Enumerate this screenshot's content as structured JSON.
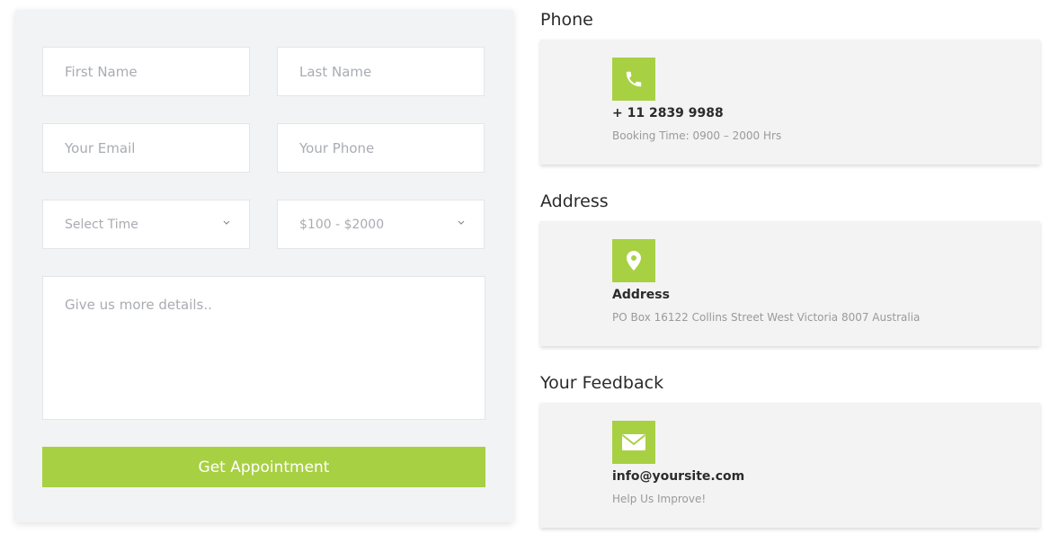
{
  "form": {
    "first_name_placeholder": "First Name",
    "last_name_placeholder": "Last Name",
    "email_placeholder": "Your Email",
    "phone_placeholder": "Your Phone",
    "time_select_value": "Select Time",
    "budget_select_value": "$100 - $2000",
    "details_placeholder": "Give us more details..",
    "submit_label": "Get Appointment"
  },
  "contact": {
    "phone": {
      "heading": "Phone",
      "title": "+ 11 2839 9988",
      "text": "Booking Time: 0900 – 2000 Hrs",
      "icon": "phone-icon"
    },
    "address": {
      "heading": "Address",
      "title": "Address",
      "text": "PO Box 16122 Collins Street West Victoria 8007 Australia",
      "icon": "map-pin-icon"
    },
    "feedback": {
      "heading": "Your Feedback",
      "title": "info@yoursite.com",
      "text": "Help Us Improve!",
      "icon": "envelope-icon"
    }
  },
  "colors": {
    "accent": "#a8d043",
    "form_bg": "#f2f3f4",
    "card_bg": "#f3f3f3"
  }
}
